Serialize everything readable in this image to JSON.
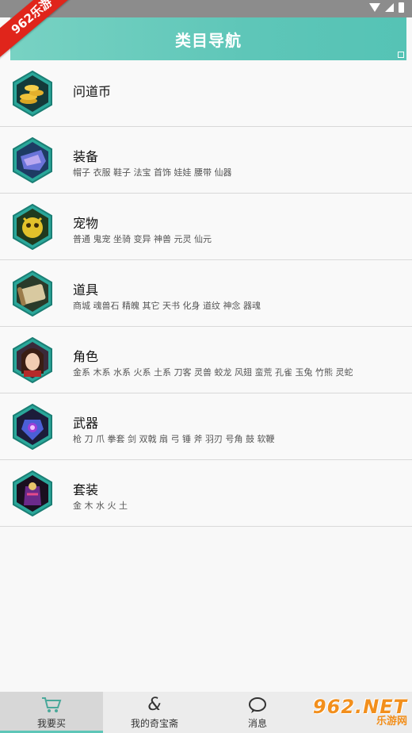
{
  "header": {
    "title": "类目导航"
  },
  "badge": {
    "text": "962乐游"
  },
  "categories": [
    {
      "title": "问道币",
      "sub": ""
    },
    {
      "title": "装备",
      "sub": "帽子  衣服  鞋子  法宝  首饰  娃娃  腰带  仙器"
    },
    {
      "title": "宠物",
      "sub": "普通  鬼宠  坐骑  变异  神兽  元灵  仙元"
    },
    {
      "title": "道具",
      "sub": "商城  魂兽石  精魄  其它  天书  化身  道纹  神念  器魂"
    },
    {
      "title": "角色",
      "sub": "金系  木系  水系  火系  土系  刀客  灵兽  蛟龙  风翅  蛮荒  孔雀  玉兔  竹熊  灵蛇"
    },
    {
      "title": "武器",
      "sub": "枪  刀  爪  拳套  剑  双戟  扇  弓  锤  斧  羽刃  号角  鼓  软鞭"
    },
    {
      "title": "套装",
      "sub": "金  木  水  火  土"
    }
  ],
  "tabs": [
    {
      "label": "我要买",
      "icon": "cart-icon"
    },
    {
      "label": "我的奇宝斋",
      "icon": "ampersand-icon"
    },
    {
      "label": "消息",
      "icon": "chat-icon"
    }
  ],
  "watermark": {
    "main": "962.NET",
    "sub": "乐游网"
  },
  "colors": {
    "accent": "#5ec6b8",
    "badge": "#e0251b",
    "watermark": "#f28f1c"
  }
}
